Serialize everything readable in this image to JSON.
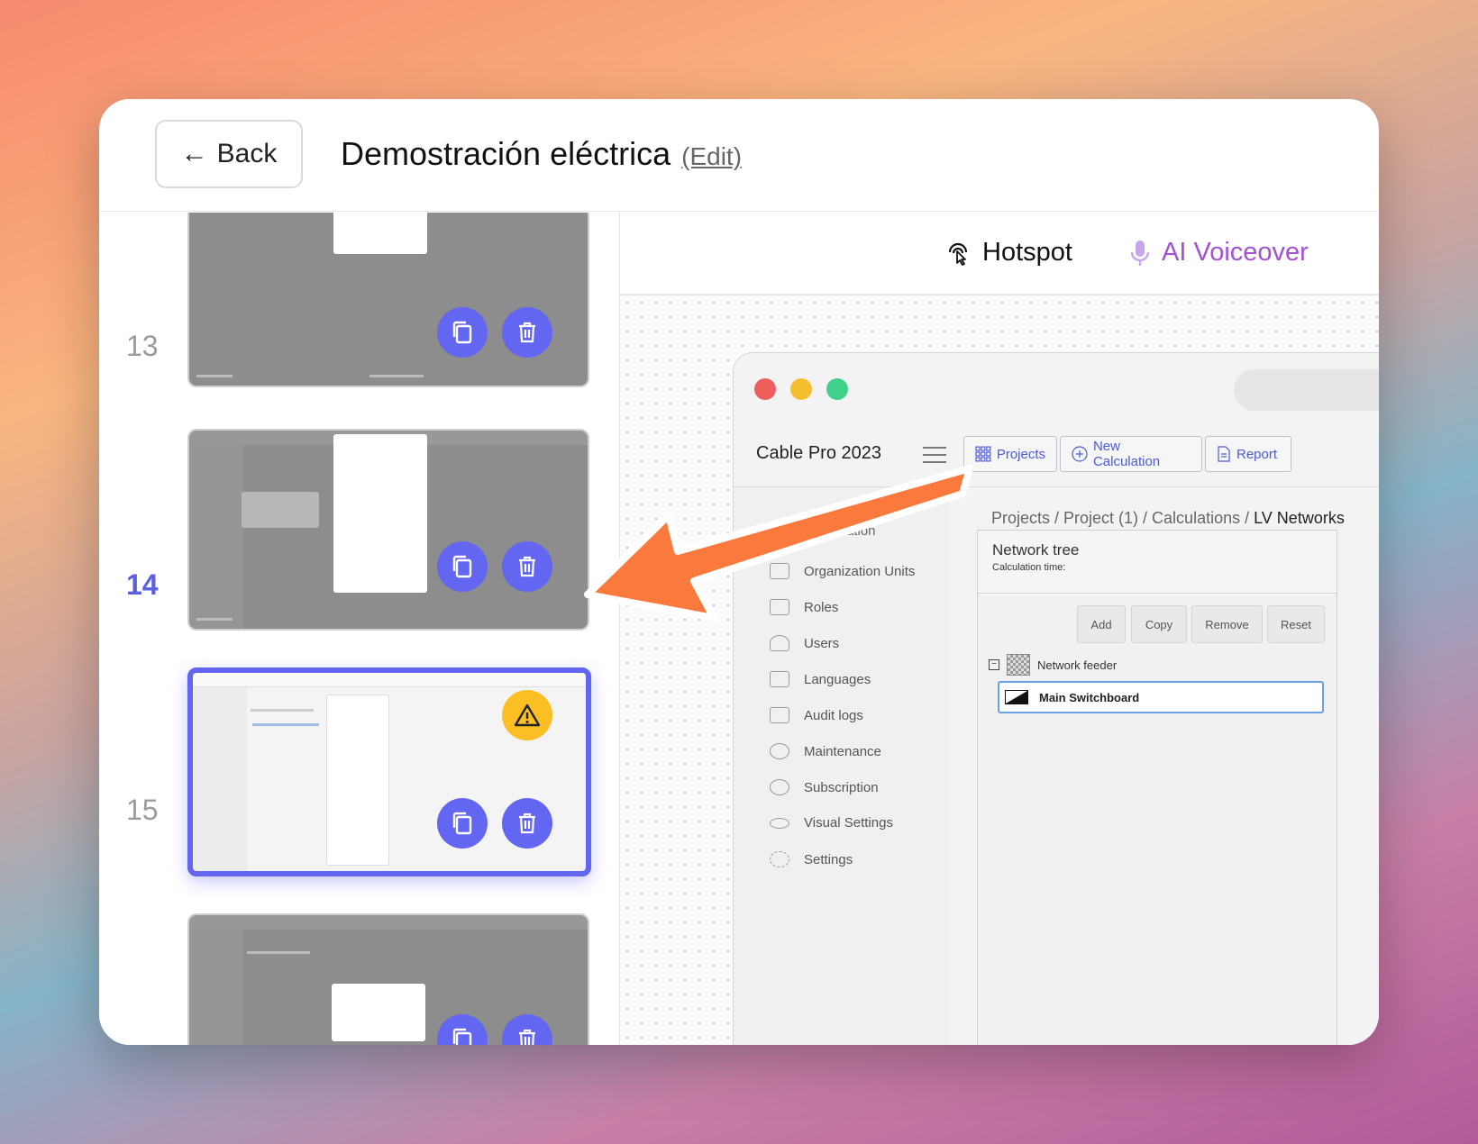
{
  "header": {
    "back_label": "Back",
    "title": "Demostración eléctrica",
    "edit_label": "(Edit)"
  },
  "slides": [
    {
      "number": "",
      "state": "partial"
    },
    {
      "number": "13",
      "state": "normal"
    },
    {
      "number": "14",
      "state": "active",
      "warning": true
    },
    {
      "number": "15",
      "state": "normal"
    }
  ],
  "tools": {
    "hotspot_label": "Hotspot",
    "voiceover_label": "AI Voiceover"
  },
  "app": {
    "title": "Cable Pro 2023",
    "buttons": {
      "projects": "Projects",
      "new_calculation": "New Calculation",
      "report": "Report"
    },
    "sidebar_partial": "ration",
    "sidebar": [
      {
        "label": "Organization Units",
        "icon": "org-units-icon"
      },
      {
        "label": "Roles",
        "icon": "briefcase-icon"
      },
      {
        "label": "Users",
        "icon": "users-icon"
      },
      {
        "label": "Languages",
        "icon": "languages-icon"
      },
      {
        "label": "Audit logs",
        "icon": "folder-icon"
      },
      {
        "label": "Maintenance",
        "icon": "maintenance-icon"
      },
      {
        "label": "Subscription",
        "icon": "refresh-icon"
      },
      {
        "label": "Visual Settings",
        "icon": "eye-icon"
      },
      {
        "label": "Settings",
        "icon": "gear-icon"
      }
    ],
    "breadcrumb_path": "Projects / Project (1) / Calculations /",
    "breadcrumb_current": "LV Networks",
    "tree": {
      "title": "Network tree",
      "subtitle": "Calculation time:",
      "buttons": [
        "Add",
        "Copy",
        "Remove",
        "Reset"
      ],
      "feeder_label": "Network feeder",
      "selected_node": "Main Switchboard"
    }
  },
  "colors": {
    "accent": "#6366f1",
    "warning": "#fbbf24",
    "voiceover": "#a44fd6",
    "arrow": "#f97a3c"
  }
}
